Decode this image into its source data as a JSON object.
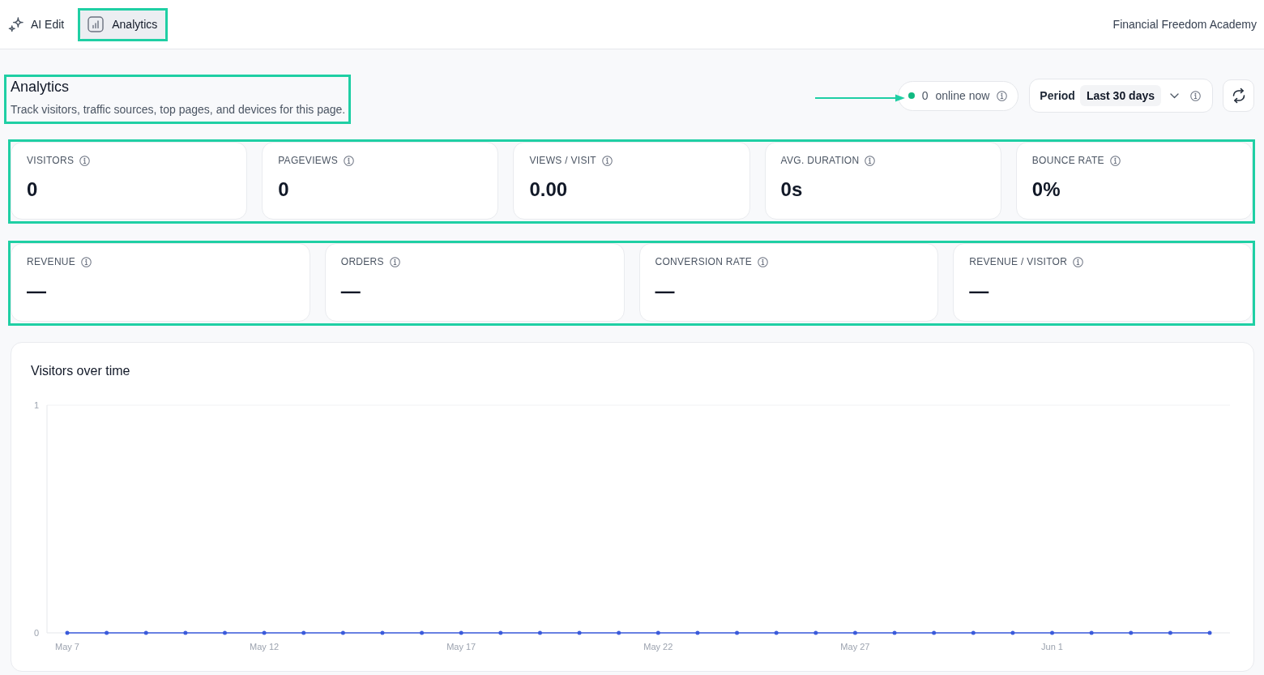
{
  "toolbar": {
    "tabs": [
      {
        "label": "AI Edit",
        "selected": false,
        "highlighted": false
      },
      {
        "label": "Analytics",
        "selected": true,
        "highlighted": true
      }
    ],
    "site_name": "Financial Freedom Academy"
  },
  "header": {
    "title": "Analytics",
    "subtitle": "Track visitors, traffic sources, top pages, and devices for this page.",
    "highlighted": true
  },
  "online": {
    "count": "0",
    "label": "online now",
    "live": true,
    "pointer_arrow": true
  },
  "period": {
    "label": "Period",
    "value": "Last 30 days"
  },
  "metric_groups": [
    {
      "highlighted": true,
      "metrics": [
        {
          "label": "VISITORS",
          "value": "0"
        },
        {
          "label": "PAGEVIEWS",
          "value": "0"
        },
        {
          "label": "VIEWS / VISIT",
          "value": "0.00"
        },
        {
          "label": "AVG. DURATION",
          "value": "0s"
        },
        {
          "label": "BOUNCE RATE",
          "value": "0%"
        }
      ]
    },
    {
      "highlighted": true,
      "metrics": [
        {
          "label": "REVENUE",
          "value": "—"
        },
        {
          "label": "ORDERS",
          "value": "—"
        },
        {
          "label": "CONVERSION RATE",
          "value": "—"
        },
        {
          "label": "REVENUE / VISITOR",
          "value": "—"
        }
      ]
    }
  ],
  "chart": {
    "chart_data": {
      "type": "line",
      "title": "Visitors over time",
      "categories": [
        "May 7",
        null,
        null,
        null,
        null,
        "May 12",
        null,
        null,
        null,
        null,
        "May 17",
        null,
        null,
        null,
        null,
        "May 22",
        null,
        null,
        null,
        null,
        "May 27",
        null,
        null,
        null,
        null,
        "Jun 1",
        null,
        null,
        null,
        null
      ],
      "values": [
        0,
        0,
        0,
        0,
        0,
        0,
        0,
        0,
        0,
        0,
        0,
        0,
        0,
        0,
        0,
        0,
        0,
        0,
        0,
        0,
        0,
        0,
        0,
        0,
        0,
        0,
        0,
        0,
        0,
        0
      ],
      "ylim": [
        0,
        1
      ],
      "yticks": [
        0,
        1
      ]
    }
  }
}
